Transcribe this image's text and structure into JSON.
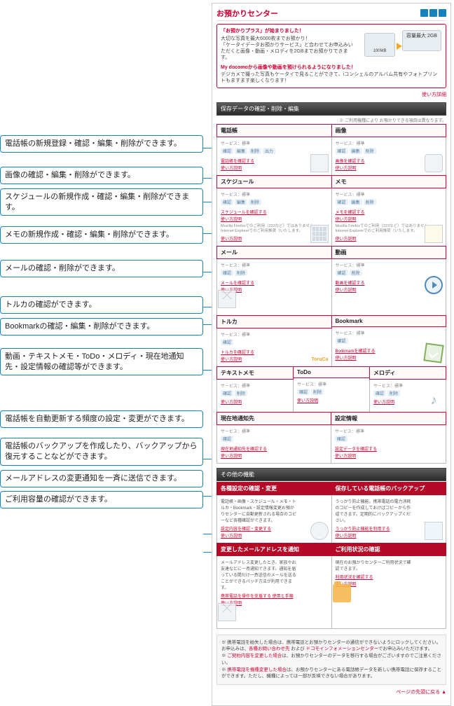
{
  "header": {
    "title": "お預かりセンター",
    "icons": [
      "phone-icon",
      "calc-icon",
      "mail-icon"
    ]
  },
  "promo": {
    "title": "「お預かりプラス」が始まりました！",
    "line1": "大切な写真を最大6000枚までお預かり！",
    "line2": "「ケータイデータお預かりサービス」と合わせてお申込みいただくと画像・動画・メロディを2GBまでお預かりできます。",
    "capacity100": "100MB",
    "capacity2gb": "容量最大 2GB",
    "sub_title": "My docomoから画像や動画を預けられるようになりました！",
    "sub_line": "デジカメで撮った写真もケータイで見ることができて、iコンシェルのアルバム共有やフォトプリントもますます楽しくなります！",
    "right_link": "使い方詳細"
  },
  "section_main": {
    "title": "保存データの確認・削除・編集",
    "note_right": "※ ご利用機種により お預かりできる項目は異なります。"
  },
  "common": {
    "service_label": "サービス：標準",
    "guide_link": "使い方説明",
    "tags_std": [
      "確認",
      "編集",
      "削除"
    ],
    "tags_edit": [
      "確認",
      "編集",
      "削除",
      "出力"
    ],
    "tags_conf": [
      "確認",
      "削除"
    ],
    "note_firefox": "Mozilla Firefoxでのご利用（223など）ではありません。Internet Explorerでのご利用推奨（いたします。"
  },
  "cards": {
    "phonebook": {
      "title": "電話帳",
      "link": "電話帳を確認する"
    },
    "images": {
      "title": "画像",
      "link": "画像を確認する"
    },
    "schedule": {
      "title": "スケジュール",
      "link": "スケジュールを確認する"
    },
    "memo": {
      "title": "メモ",
      "link": "メモを確認する"
    },
    "mail": {
      "title": "メール",
      "link": "メールを確認する"
    },
    "video": {
      "title": "動画",
      "link": "動画を確認する"
    },
    "toruca": {
      "title": "トルカ",
      "link": "トルカを確認する"
    },
    "bookmark": {
      "title": "Bookmark",
      "link": "Bookmarkを確認する"
    },
    "textmemo": {
      "title": "テキストメモ",
      "link": ""
    },
    "todo": {
      "title": "ToDo",
      "link": ""
    },
    "melody": {
      "title": "メロディ",
      "link": ""
    },
    "location": {
      "title": "現在地通知先",
      "link": "現在地通知先を確認する"
    },
    "settings": {
      "title": "設定情報",
      "link": "設定データを確認する"
    }
  },
  "other_section": {
    "title": "その他の機能"
  },
  "other_cards": {
    "settings_change": {
      "title": "各種設定の確認・変更",
      "desc": "電話帳・画像・スケジュール・メモ・トルカ・Bookmark・設定情報変更お預かりセンターに自動更新される場合のコピーなど各種確認ができます。",
      "link1": "設定内容を確認・変更する",
      "link2": "使い方説明"
    },
    "backup": {
      "title": "保存している電話帳のバックアップ",
      "desc": "うっかり防止機能。携帯電話の電力消耗のコピーを作成しておけばコピーから作成できます。定期的にバックアップください。",
      "link1": "うっかり防止機能を利用する",
      "link2": "使い方説明"
    },
    "mail_notify": {
      "title": "変更したメールアドレスを通知",
      "desc": "メールアドレス変更したとき、家族やお友達などに一斉通知できます。通知を届っている間だけ一斉送信のメールを送ることができるパッチ方法が利用できます。",
      "link1": "携帯電話を操作を支援する 使用と手順",
      "link2": "使い方説明"
    },
    "usage": {
      "title": "ご利用状況の確認",
      "desc": "現在のお預かりセンターご利用状況で確認できます。",
      "link1": "利用状況を確認する",
      "link2": "使い方説明"
    }
  },
  "notes": {
    "n1": "※ 携帯電話を紛失した場合は、携帯電話とお預かりセンターの通信ができないようにロックしてください。お申込みは、各種お問い合わせ先 および ドコモインフォメーションセンターでお申込みいただけます。",
    "n1_link1": "各種お問い合わせ先",
    "n1_link2": "ドコモインフォメーションセンター",
    "n2": "※ ご契約内容を変更した場合は、お預かりセンターのデータを移行する場合がございますのでご注意ください。",
    "n2_link": "ご契約内容を変更した場合",
    "n3": "※ 携帯電話を機種変更した場合は、お預かりセンターにある電話帳データを新しい携帯電話に保存することができます。ただし、機種によっては一部が反映できない場合があります。",
    "n3_link": "携帯電話を機種変更した場合"
  },
  "foot_link": "ページの先頭に戻る ▲",
  "callouts": [
    "電話帳の新規登録・確認・編集・削除ができます。",
    "画像の確認・編集・削除ができます。",
    "スケジュールの新規作成・確認・編集・削除ができます。",
    "メモの新規作成・確認・編集・削除ができます。",
    "メールの確認・削除ができます。",
    "トルカの確認ができます。",
    "Bookmarkの確認・編集・削除ができます。",
    "動画・テキストメモ・ToDo・メロディ・現在地通知先・設定情報の確認等ができます。",
    "電話帳を自動更新する頻度の設定・変更ができます。",
    "電話帳のバックアップを作成したり、バックアップから復元することなどができます。",
    "メールアドレスの変更通知を一斉に送信できます。",
    "ご利用容量の確認ができます。"
  ]
}
